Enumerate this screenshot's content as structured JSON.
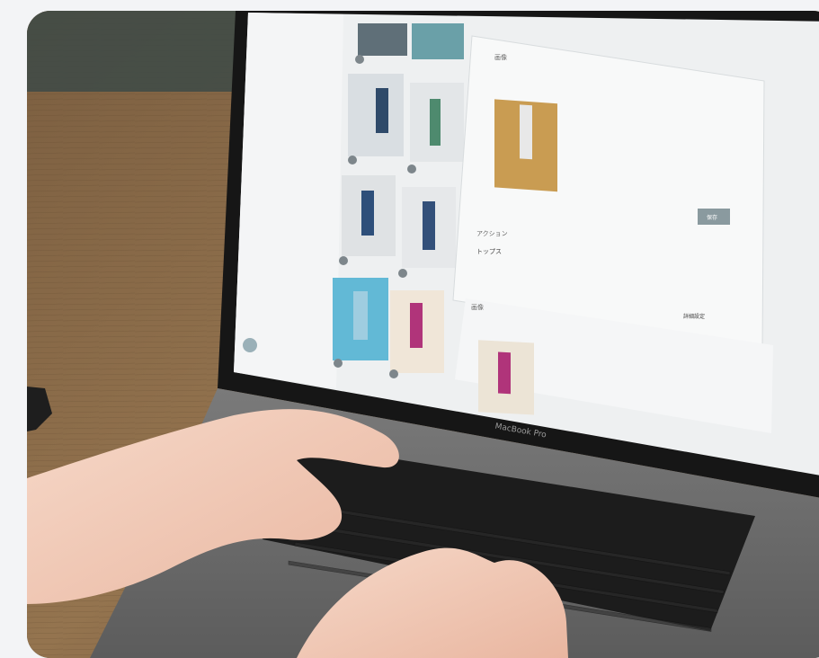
{
  "photo": {
    "subject": "Person typing on a laptop displaying a fashion outfit management interface",
    "laptop_brand": "MacBook Pro",
    "screen": {
      "panel_heading_top": "画像",
      "panel_heading_bottom": "画像",
      "field_label": "アクション",
      "field_value": "トップス",
      "button_primary": "保存",
      "button_secondary": "詳細設定"
    },
    "colors": {
      "background": "#f3f4f6",
      "desk": "#8a6a48",
      "laptop_body": "#6e6e6e",
      "screen_bg": "#eef0f1",
      "keyboard": "#1c1c1c",
      "skin": "#f1c8b4"
    }
  }
}
